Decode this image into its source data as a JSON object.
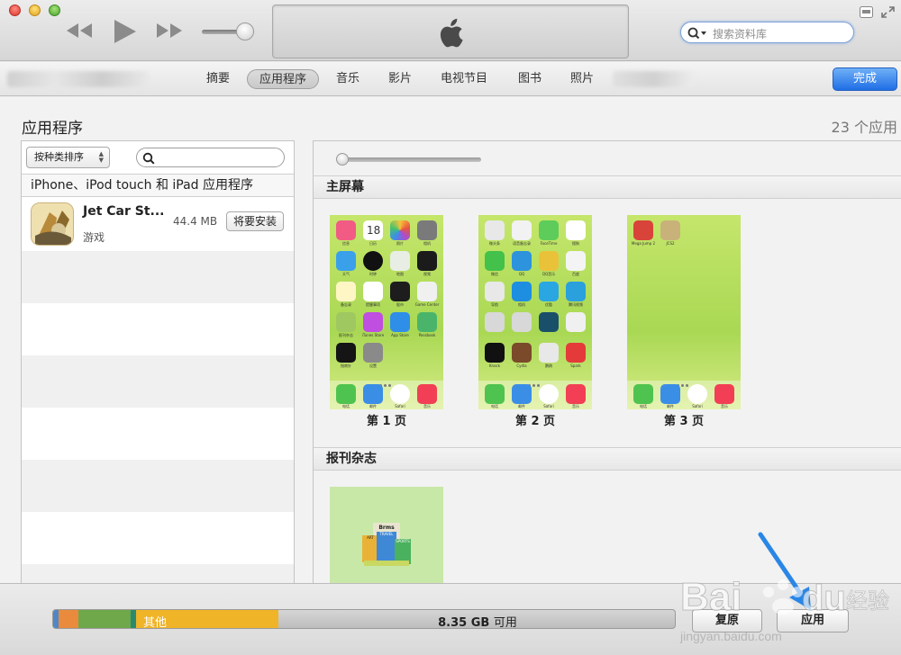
{
  "toolbar": {
    "search_placeholder": "搜索资料库"
  },
  "tabs": [
    {
      "label": "摘要"
    },
    {
      "label": "应用程序",
      "active": true
    },
    {
      "label": "音乐"
    },
    {
      "label": "影片"
    },
    {
      "label": "电视节目"
    },
    {
      "label": "图书"
    },
    {
      "label": "照片"
    }
  ],
  "done_label": "完成",
  "section": {
    "title": "应用程序",
    "app_count": "23 个应用"
  },
  "left_panel": {
    "sort_label": "按种类排序",
    "list_header": "iPhone、iPod touch 和 iPad 应用程序",
    "apps": [
      {
        "name": "Jet Car St...",
        "category": "游戏",
        "size": "44.4 MB",
        "action": "将要安装"
      }
    ]
  },
  "right_panel": {
    "home_screen_title": "主屏幕",
    "pages": [
      {
        "label": "第 1 页"
      },
      {
        "label": "第 2 页"
      },
      {
        "label": "第 3 页"
      }
    ],
    "page1_icons": [
      "信息",
      "日历",
      "照片",
      "相机",
      "天气",
      "时钟",
      "地图",
      "视频",
      "备忘录",
      "提醒事项",
      "股市",
      "Game Center",
      "报刊杂志",
      "iTunes Store",
      "App Store",
      "Passbook",
      "指南针",
      "设置"
    ],
    "page2_icons": [
      "微头条",
      "语音备忘录",
      "FaceTime",
      "搜狗",
      "微信",
      "QQ",
      "QQ音乐",
      "百度",
      "导航",
      "相机",
      "优酷",
      "腾讯视频",
      "Knock",
      "Cydia",
      "鹦鹉",
      "Spark"
    ],
    "page3_icons": [
      "Mega Jump 2",
      "JCS2"
    ],
    "dock_icons": [
      "电话",
      "邮件",
      "Safari",
      "音乐"
    ],
    "newsstand_title": "报刊杂志",
    "newsstand_magazine_text": [
      "Brms",
      "ART",
      "TRAVEL",
      "SPORTS"
    ]
  },
  "bottom": {
    "capacity_other_label": "其他",
    "free_value": "8.35 GB",
    "free_unit": "可用",
    "revert_label": "复原",
    "apply_label": "应用"
  },
  "colors": {
    "accent_blue": "#1f6ee6",
    "wallpaper_green": "#a9d854",
    "capacity_audio": "#4f86c6",
    "capacity_video": "#e98a3c",
    "capacity_photos": "#6fa84a",
    "capacity_apps": "#2b8a6e",
    "capacity_other": "#f0b428"
  },
  "watermark": "Baidu 经验 jingyan.baidu.com"
}
